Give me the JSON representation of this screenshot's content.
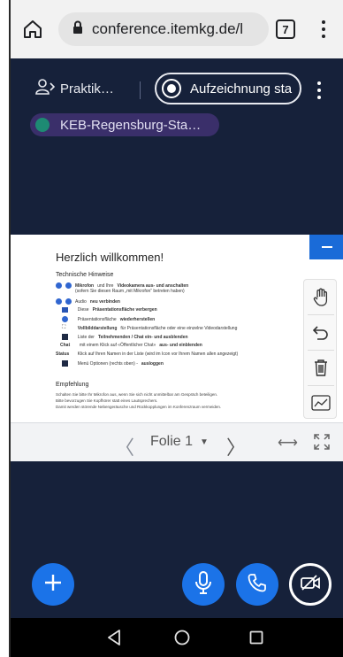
{
  "browser": {
    "url": "conference.itemkg.de/l",
    "tab_count": "7",
    "home_icon": "home-icon",
    "lock_icon": "lock-icon",
    "menu_icon": "more-vert-icon"
  },
  "header": {
    "participants_label": "Praktik…",
    "record_label": "Aufzeichnung sta",
    "breakout_room": "KEB-Regensburg-Sta…"
  },
  "slide": {
    "title": "Herzlich willkommen!",
    "subtitle": "Technische Hinweise",
    "lines": [
      {
        "prefix": "",
        "bold": "Mikrofon",
        "text": " und Ihre ",
        "bold2": "Videokamera aus- und anschalten"
      },
      {
        "prefix": "",
        "bold": "",
        "text": "(sofern Sie diesen Raum „mit Mikrofon“ betreten haben)",
        "bold2": ""
      },
      {
        "prefix": "",
        "bold": "",
        "text": "Audio ",
        "bold2": "neu verbinden"
      },
      {
        "prefix": "",
        "bold": "",
        "text": "Diese ",
        "bold2": "Präsentationsfläche verbergen"
      },
      {
        "prefix": "",
        "bold": "",
        "text": "Präsentationsfläche ",
        "bold2": "wiederherstellen"
      },
      {
        "prefix": "",
        "bold": "Vollbilddarstellung",
        "text": " für Präsentationsfläche oder eine einzelne Videodarstellung",
        "bold2": ""
      },
      {
        "prefix": "",
        "bold": "",
        "text": "Liste der ",
        "bold2": "Teilnehmenden / Chat ein- und ausblenden"
      },
      {
        "prefix": "Chat",
        "bold": "",
        "text": "mit einem Klick auf «Öffentlicher Chat» ",
        "bold2": "aus- und einblenden"
      },
      {
        "prefix": "Status",
        "bold": "",
        "text": "Klick auf Ihren Namen in der Liste (wird im Icon vor Ihrem Namen allen angezeigt)",
        "bold2": ""
      },
      {
        "prefix": "",
        "bold": "",
        "text": "Menü Optionen (rechts oben) - ",
        "bold2": "ausloggen"
      }
    ],
    "empf_title": "Empfehlung",
    "empf_lines": [
      "Schalten Sie bitte Ihr Mikrofon aus, wenn Sie sich nicht unmittelbar am Gespräch beteiligen.",
      "Bitte bevorzugen Sie Kopfhörer statt eines Lautsprechers.",
      "Damit werden störende Nebengeräusche und Rückkopplungen im Konferenzraum vermeiden."
    ]
  },
  "tools": [
    "hand-icon",
    "undo-icon",
    "trash-icon",
    "chart-icon"
  ],
  "slide_nav": {
    "current": "Folie 1",
    "prev": "〈",
    "next": "〉",
    "fit": "⟷"
  },
  "colors": {
    "background": "#16213a",
    "accent": "#1b73e8",
    "chip": "#3a2f6a",
    "chip_dot": "#1e8a73"
  }
}
